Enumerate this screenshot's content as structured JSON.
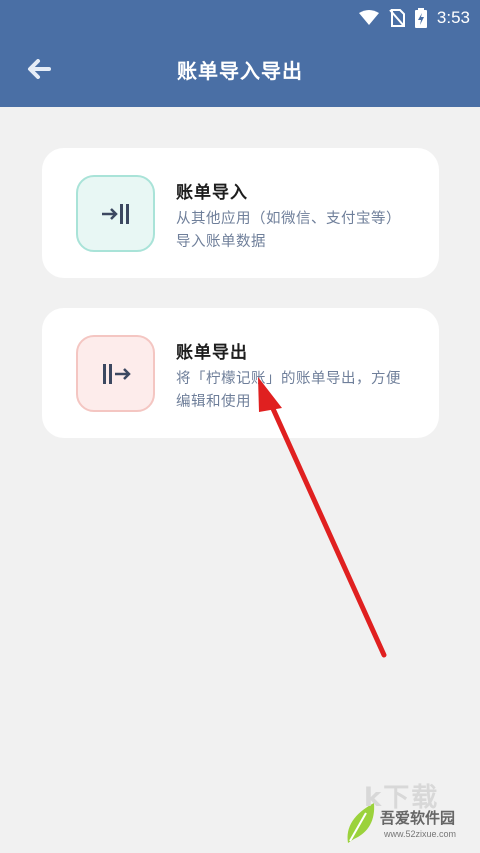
{
  "status_bar": {
    "time": "3:53",
    "icons": [
      "wifi-icon",
      "no-sim-icon",
      "battery-charging-icon"
    ]
  },
  "header": {
    "title": "账单导入导出",
    "back_icon": "back-arrow-icon",
    "background": "#4a6fa5"
  },
  "cards": {
    "import": {
      "title": "账单导入",
      "description": "从其他应用（如微信、支付宝等）导入账单数据",
      "icon": "import-arrow-bar-icon"
    },
    "export": {
      "title": "账单导出",
      "description": "将「柠檬记账」的账单导出，方便编辑和使用",
      "icon": "export-bar-arrow-icon"
    }
  },
  "watermark": {
    "big_text": "k下载",
    "name": "吾爱软件园",
    "url": "www.52zixue.com"
  },
  "colors": {
    "accent": "#4a6fa5",
    "annotation_arrow": "#e02020"
  }
}
